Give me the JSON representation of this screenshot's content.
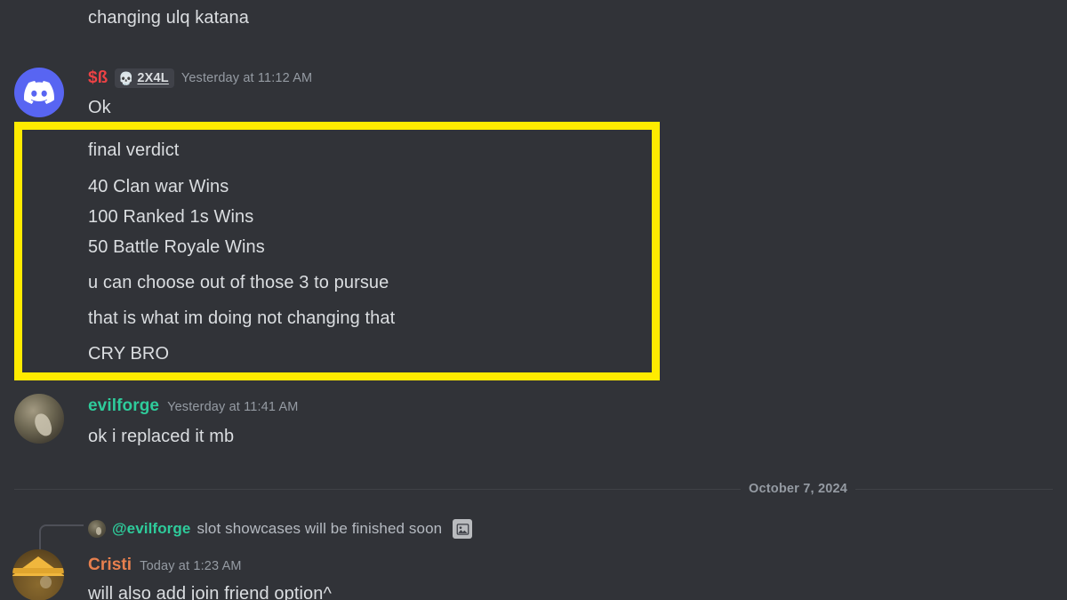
{
  "app": {
    "name": "Discord",
    "theme_background": "#313338"
  },
  "colors": {
    "background": "#313338",
    "highlight_border": "#ffeb00",
    "text_primary": "#dbdee1",
    "text_muted": "#959ba3",
    "name_red": "#ed4245",
    "name_teal": "#2ecc9b",
    "name_orange": "#e8804e",
    "discord_blurple": "#5865f2",
    "divider": "#3f4147"
  },
  "top_partial_message": {
    "text": "changing ulq katana"
  },
  "messages": [
    {
      "id": "msg-1",
      "author": "$ß",
      "author_color": "#ed4245",
      "badge": {
        "emoji": "skull-emoji",
        "glyph": "💀",
        "label": "2X4L"
      },
      "timestamp": "Yesterday at 11:12 AM",
      "avatar": "discord-logo-avatar",
      "lines": [
        "Ok"
      ],
      "highlighted_lines": [
        "final verdict",
        "40 Clan war Wins",
        "100 Ranked 1s Wins",
        "50 Battle Royale Wins",
        "u can choose out of those 3 to pursue",
        "that is what im doing not changing that",
        "CRY BRO"
      ]
    },
    {
      "id": "msg-2",
      "author": "evilforge",
      "author_color": "#2ecc9b",
      "timestamp": "Yesterday at 11:41 AM",
      "avatar": "evilforge-avatar",
      "lines": [
        "ok i replaced it mb"
      ]
    }
  ],
  "date_divider": {
    "label": "October 7, 2024"
  },
  "reply_message": {
    "id": "msg-3",
    "reply_preview": {
      "avatar": "evilforge-reply-avatar",
      "mention": "@evilforge",
      "text": "slot showcases will be finished soon",
      "attachment_icon": "image-icon"
    },
    "author": "Cristi",
    "author_color": "#e8804e",
    "timestamp": "Today at 1:23 AM",
    "avatar": "cristi-straw-hat-avatar",
    "lines": [
      "will also add join friend option^"
    ]
  }
}
